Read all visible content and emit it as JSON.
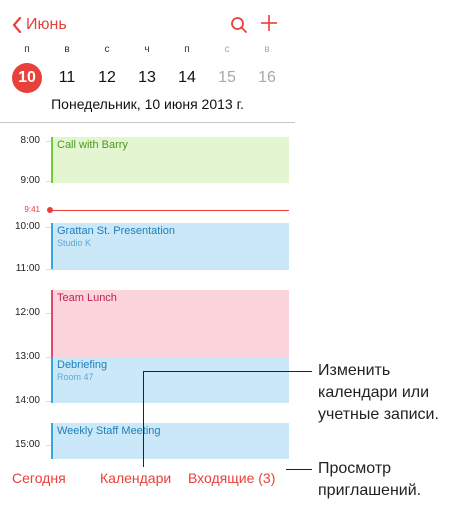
{
  "nav": {
    "back_label": "Июнь"
  },
  "week": [
    {
      "letter": "п",
      "num": "10",
      "today": true,
      "weekend": false
    },
    {
      "letter": "в",
      "num": "11",
      "today": false,
      "weekend": false
    },
    {
      "letter": "с",
      "num": "12",
      "today": false,
      "weekend": false
    },
    {
      "letter": "ч",
      "num": "13",
      "today": false,
      "weekend": false
    },
    {
      "letter": "п",
      "num": "14",
      "today": false,
      "weekend": false
    },
    {
      "letter": "с",
      "num": "15",
      "today": false,
      "weekend": true
    },
    {
      "letter": "в",
      "num": "16",
      "today": false,
      "weekend": true
    }
  ],
  "date_title": "Понедельник, 10 июня 2013 г.",
  "hours": [
    "8:00",
    "9:00",
    "10:00",
    "11:00",
    "12:00",
    "13:00",
    "14:00",
    "15:00"
  ],
  "now": "9:41",
  "events": [
    {
      "title": "Call with Barry",
      "subtitle": "",
      "color": "green"
    },
    {
      "title": "Grattan St. Presentation",
      "subtitle": "Studio K",
      "color": "blue"
    },
    {
      "title": "Team Lunch",
      "subtitle": "",
      "color": "pink"
    },
    {
      "title": "Debriefing",
      "subtitle": "Room 47",
      "color": "blue"
    },
    {
      "title": "Weekly Staff Meeting",
      "subtitle": "",
      "color": "blue"
    }
  ],
  "toolbar": {
    "today": "Сегодня",
    "calendars": "Календари",
    "inbox": "Входящие (3)"
  },
  "callouts": {
    "calendars": [
      "Изменить",
      "календари или",
      "учетные записи."
    ],
    "inbox": [
      "Просмотр",
      "приглашений."
    ]
  },
  "colors": {
    "accent": "#e8403a"
  }
}
